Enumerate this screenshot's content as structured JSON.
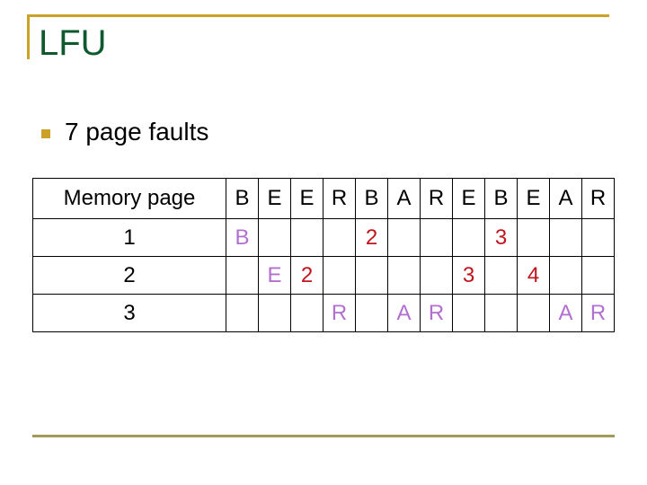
{
  "slide": {
    "title": "LFU",
    "bullets": [
      "7 page faults"
    ],
    "accent_color": "#c9a227",
    "title_color": "#0e5a2e"
  },
  "table": {
    "header_label": "Memory page",
    "reference_string": [
      "B",
      "E",
      "E",
      "R",
      "B",
      "A",
      "R",
      "E",
      "B",
      "E",
      "A",
      "R"
    ],
    "rows": [
      {
        "label": "1",
        "cells": [
          {
            "text": "B",
            "color": "purple"
          },
          {
            "text": ""
          },
          {
            "text": ""
          },
          {
            "text": ""
          },
          {
            "text": "2",
            "color": "red"
          },
          {
            "text": ""
          },
          {
            "text": ""
          },
          {
            "text": ""
          },
          {
            "text": "3",
            "color": "red"
          },
          {
            "text": ""
          },
          {
            "text": ""
          },
          {
            "text": ""
          }
        ]
      },
      {
        "label": "2",
        "cells": [
          {
            "text": ""
          },
          {
            "text": "E",
            "color": "purple"
          },
          {
            "text": "2",
            "color": "red"
          },
          {
            "text": ""
          },
          {
            "text": ""
          },
          {
            "text": ""
          },
          {
            "text": ""
          },
          {
            "text": "3",
            "color": "red"
          },
          {
            "text": ""
          },
          {
            "text": "4",
            "color": "red"
          },
          {
            "text": ""
          },
          {
            "text": ""
          }
        ]
      },
      {
        "label": "3",
        "cells": [
          {
            "text": ""
          },
          {
            "text": ""
          },
          {
            "text": ""
          },
          {
            "text": "R",
            "color": "purple"
          },
          {
            "text": ""
          },
          {
            "text": "A",
            "color": "purple"
          },
          {
            "text": "R",
            "color": "purple"
          },
          {
            "text": ""
          },
          {
            "text": ""
          },
          {
            "text": ""
          },
          {
            "text": "A",
            "color": "purple"
          },
          {
            "text": "R",
            "color": "purple"
          }
        ]
      }
    ]
  }
}
